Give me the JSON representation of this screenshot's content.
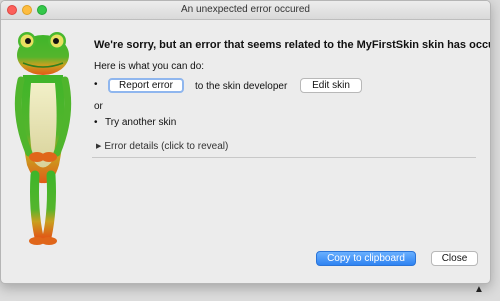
{
  "window": {
    "title": "An unexpected error occured"
  },
  "content": {
    "heading": "We're sorry, but an error that seems related to the MyFirstSkin skin has occured.",
    "intro": "Here is what you can do:",
    "report_button": "Report error",
    "to_developer": "to the skin developer",
    "edit_button": "Edit skin",
    "or_text": "or",
    "try_another": "Try another skin",
    "details_toggle": "Error details (click to reveal)"
  },
  "footer": {
    "copy_button": "Copy to clipboard",
    "close_button": "Close"
  },
  "icons": {
    "frog": "frog-mascot-icon",
    "warning": "warning-icon",
    "details": "disclosure-triangle-icon"
  }
}
